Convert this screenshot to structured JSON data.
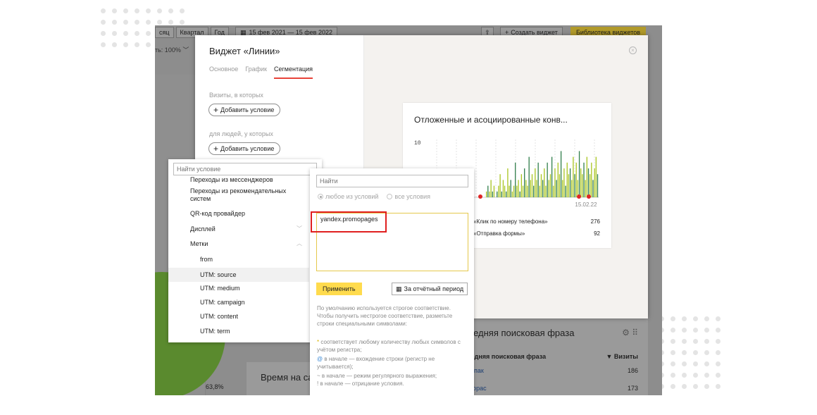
{
  "background": {
    "period_buttons": [
      "сяц",
      "Квартал",
      "Год"
    ],
    "date_range": "15 фев 2021 — 15 фев 2022",
    "zoom_label": "ть: 100%",
    "create_widget": "Создать виджет",
    "widget_library": "Библиотека виджетов",
    "search_phrase_card": {
      "title": "следняя поисковая фраза",
      "col_phrase": "следняя поисковая фраза",
      "col_visits": "▼ Визиты",
      "rows": [
        {
          "phrase": "аропак",
          "visits": "186"
        },
        {
          "phrase": "негорас",
          "visits": "173"
        }
      ]
    },
    "time_card_title": "Время на сай",
    "pie_percent": "63,8%"
  },
  "modal": {
    "title": "Виджет «Линии»",
    "tabs": [
      {
        "label": "Основное",
        "active": false
      },
      {
        "label": "График",
        "active": false
      },
      {
        "label": "Сегментация",
        "active": true
      }
    ],
    "visits_label": "Визиты, в которых",
    "people_label": "для людей, у которых",
    "add_condition": "Добавить условие"
  },
  "preview": {
    "title": "Отложенные и асоциированные конв...",
    "y_max_label": "10",
    "date_label": "15.02.22",
    "legend": [
      {
        "label": "«Клик по номеру телефона»",
        "value": "276"
      },
      {
        "label": "«Отправка формы»",
        "value": "92"
      }
    ]
  },
  "chart_data": {
    "type": "bar",
    "ylim": [
      0,
      10
    ],
    "series": [
      {
        "name": "«Клик по номеру телефона»",
        "color": "#a8c41f"
      },
      {
        "name": "«Отправка формы»",
        "color": "#2f7d4a"
      }
    ],
    "bars": [
      1,
      2,
      1,
      3,
      1,
      2,
      0,
      1,
      2,
      4,
      1,
      3,
      2,
      1,
      5,
      2,
      3,
      1,
      2,
      6,
      2,
      3,
      1,
      4,
      2,
      5,
      3,
      2,
      7,
      3,
      4,
      2,
      5,
      3,
      6,
      2,
      4,
      3,
      5,
      2,
      6,
      3,
      4,
      7,
      2,
      5,
      3,
      6,
      4,
      8,
      3,
      5,
      2,
      6,
      4,
      5,
      3,
      7,
      4,
      6,
      3,
      8,
      5,
      4,
      6,
      3,
      7,
      5,
      4,
      6,
      3,
      5,
      7,
      4
    ]
  },
  "condition_list": {
    "search_placeholder": "Найти условие",
    "items": [
      {
        "label": "Переходы из мессенджеров",
        "level": 1,
        "chevron": ""
      },
      {
        "label": "Переходы из рекомендательных систем",
        "level": 1,
        "chevron": ""
      },
      {
        "label": "QR-код провайдер",
        "level": 1,
        "chevron": ""
      },
      {
        "label": "Дисплей",
        "level": 1,
        "chevron": "﹀"
      },
      {
        "label": "Метки",
        "level": 1,
        "chevron": "︿"
      },
      {
        "label": "from",
        "level": 2,
        "chevron": ""
      },
      {
        "label": "UTM: source",
        "level": 2,
        "chevron": "",
        "selected": true
      },
      {
        "label": "UTM: medium",
        "level": 2,
        "chevron": ""
      },
      {
        "label": "UTM: campaign",
        "level": 2,
        "chevron": ""
      },
      {
        "label": "UTM: content",
        "level": 2,
        "chevron": ""
      },
      {
        "label": "UTM: term",
        "level": 2,
        "chevron": ""
      }
    ]
  },
  "value_panel": {
    "search_placeholder": "Найти",
    "radio_any": "любое из условий",
    "radio_all": "все условия",
    "value_text": "yandex.promopages",
    "apply": "Применить",
    "period": "За отчётный период",
    "help_main": "По умолчанию используется строгое соответствие. Чтобы получить нестрогое соответствие, разметьте строки специальными символами:",
    "help_star_sym": "*",
    "help_star": " соответствует любому количеству любых символов с учётом регистра;",
    "help_at_sym": "@",
    "help_at": " в начале — вхождение строки (регистр не учитывается);",
    "help_tilde": "~ в начале — режим регулярного выражения;",
    "help_excl": "! в начале — отрицание условия."
  }
}
